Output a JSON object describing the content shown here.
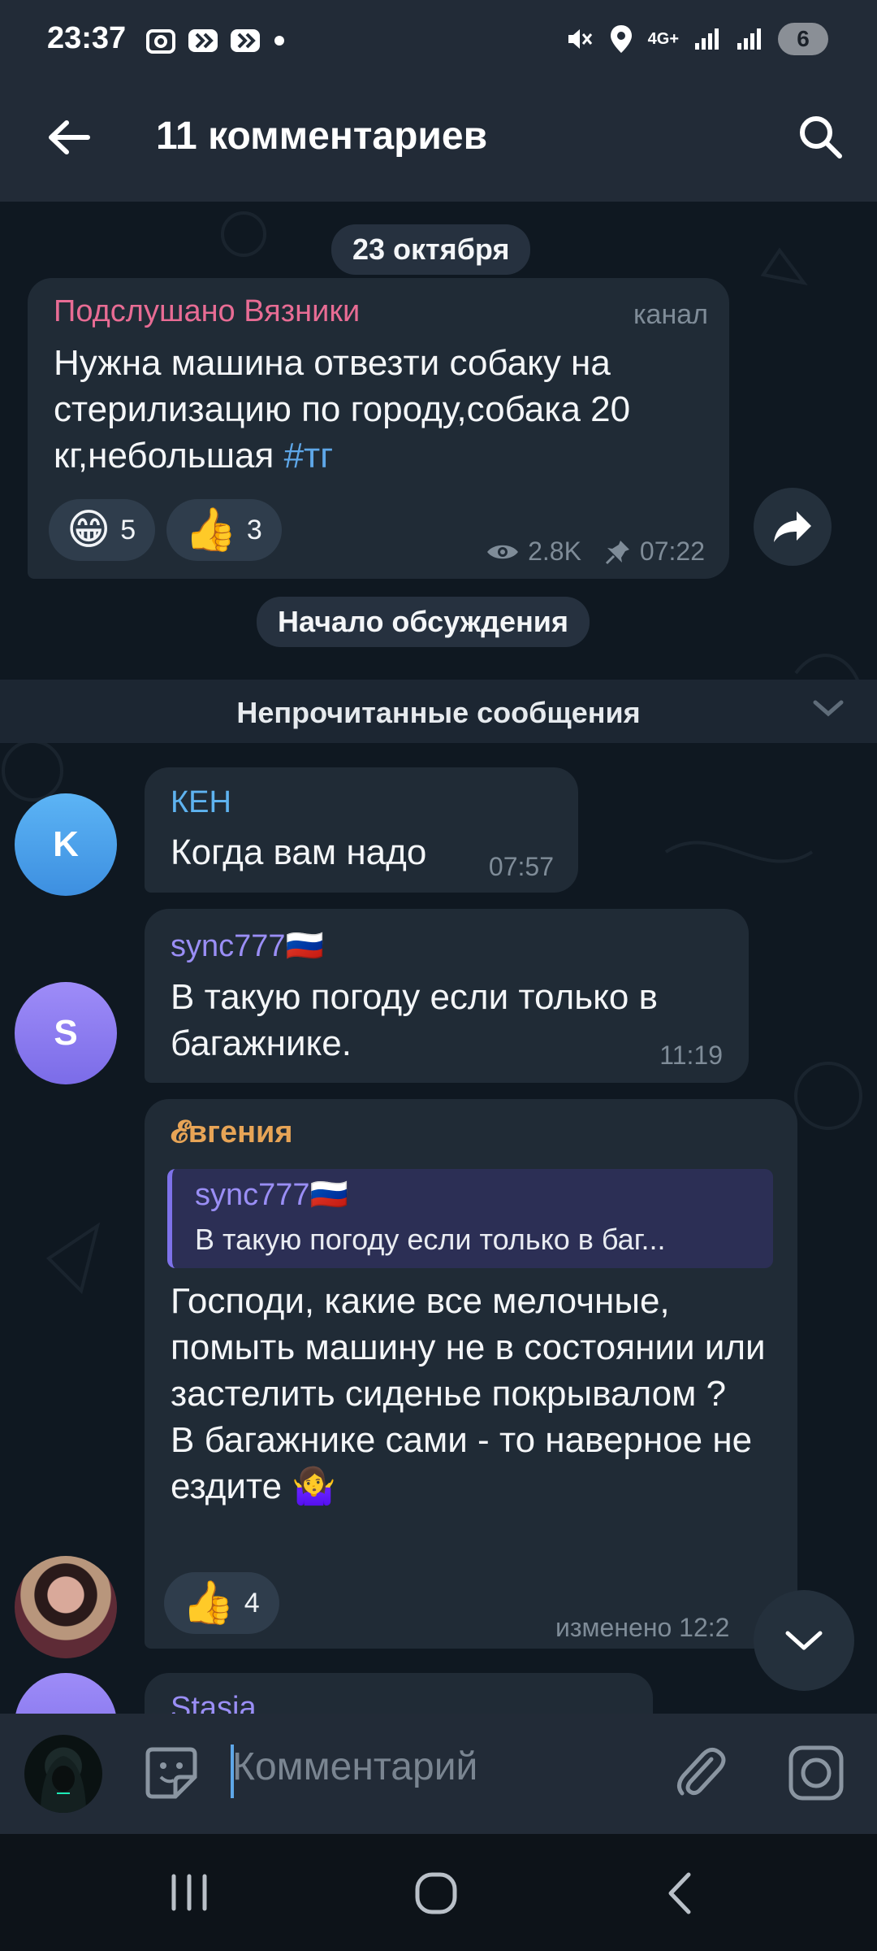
{
  "status": {
    "time": "23:37",
    "battery": "6",
    "network": "4G+"
  },
  "header": {
    "title": "11 комментариев"
  },
  "date_pill": "23 октября",
  "channel_post": {
    "author": "Подслушано Вязники",
    "author_type": "канал",
    "text": "Нужна машина отвезти собаку на стерилизацию по городу,собака 20 кг,небольшая ",
    "hashtag": "#тг",
    "reactions": [
      {
        "emoji": "😁",
        "count": "5"
      },
      {
        "emoji": "👍",
        "count": "3"
      }
    ],
    "views": "2.8K",
    "time": "07:22"
  },
  "discussion_start": "Начало обсуждения",
  "unread_label": "Непрочитанные сообщения",
  "messages": [
    {
      "author": "КЕН",
      "avatar_letter": "K",
      "text": "Когда вам надо",
      "time": "07:57"
    },
    {
      "author": "sync777🇷🇺",
      "avatar_letter": "S",
      "text": "В такую погоду если только в багажнике.",
      "time": "11:19"
    },
    {
      "author": "𝓔вгения",
      "quote_author": "sync777🇷🇺",
      "quote_text": "В такую погоду если только в баг...",
      "text": "Господи, какие все мелочные, помыть машину не в состоянии или застелить сиденье покрывалом ?\nВ багажнике сами - то наверное не ездите 🤷‍♀️",
      "reaction": {
        "emoji": "👍",
        "count": "4"
      },
      "time": "изменено 12:2"
    },
    {
      "author": "Stasia"
    }
  ],
  "composer": {
    "placeholder": "Комментарий"
  },
  "colors": {
    "header_bg": "#222b37",
    "chat_bg": "#0f1821",
    "bubble_bg": "#202b36",
    "channel_name": "#e86c94",
    "accent_blue": "#5ea7e8"
  }
}
